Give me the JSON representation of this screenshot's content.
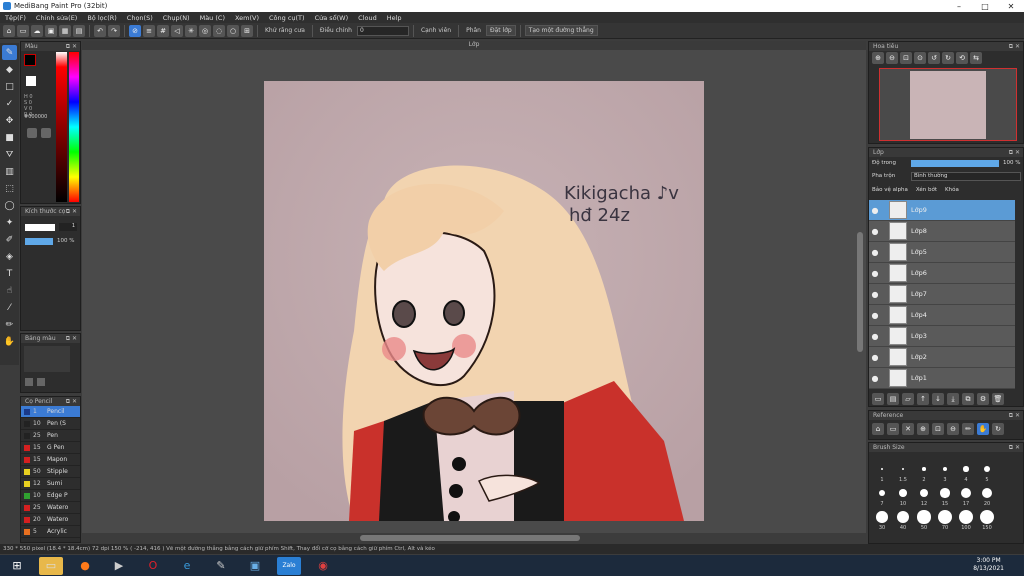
{
  "window": {
    "title": "MediBang Paint Pro (32bit)"
  },
  "menu": [
    "Tệp(F)",
    "Chỉnh sửa(E)",
    "Bộ lọc(R)",
    "Chọn(S)",
    "Chụp(N)",
    "Màu (C)",
    "Xem(V)",
    "Công cụ(T)",
    "Cửa sổ(W)",
    "Cloud",
    "Help"
  ],
  "toolbar": {
    "antialias_label": "Khử răng cưa",
    "adjust_label": "Điều chỉnh",
    "adjust_value": "0",
    "edge_label": "Cạnh viên",
    "fill_label": "Phân",
    "layer_select_label": "Đặt lớp",
    "new_shape_label": "Tạo một đường thẳng"
  },
  "color_panel": {
    "title": "Màu",
    "hex": "#000000"
  },
  "brush_size_panel": {
    "title": "Kích thước cọ",
    "size": "1",
    "opacity": "100 %"
  },
  "color_bar_panel": {
    "title": "Bảng màu"
  },
  "brush_panel": {
    "title": "Cọ Pencil",
    "brushes": [
      {
        "num": "1",
        "name": "Pencil",
        "color": "#1a3a8a"
      },
      {
        "num": "10",
        "name": "Pen (S",
        "color": "#222222"
      },
      {
        "num": "25",
        "name": "Pen",
        "color": "#222222"
      },
      {
        "num": "15",
        "name": "G Pen",
        "color": "#d42020"
      },
      {
        "num": "15",
        "name": "Mapon",
        "color": "#d42020"
      },
      {
        "num": "50",
        "name": "Stipple",
        "color": "#e8d020"
      },
      {
        "num": "12",
        "name": "Sumi",
        "color": "#e8d020"
      },
      {
        "num": "10",
        "name": "Edge P",
        "color": "#30a030"
      },
      {
        "num": "25",
        "name": "Watero",
        "color": "#d42020"
      },
      {
        "num": "20",
        "name": "Watero",
        "color": "#d42020"
      },
      {
        "num": "5",
        "name": "Acrylic",
        "color": "#e87020"
      }
    ]
  },
  "document": {
    "tab": "Lớp",
    "signature_line1": "Kikigacha ♪v",
    "signature_line2": "hđ 24z"
  },
  "navigator": {
    "title": "Hoa tiêu"
  },
  "layers_panel": {
    "title": "Lớp",
    "opacity_label": "Độ trong",
    "opacity_value": "100 %",
    "blend_label": "Pha trộn",
    "blend_value": "Bình thường",
    "protect_alpha": "Bảo vệ alpha",
    "clipping": "Xén bớt",
    "lock": "Khóa",
    "layers": [
      "Lớp9",
      "Lớp8",
      "Lớp5",
      "Lớp6",
      "Lớp7",
      "Lớp4",
      "Lớp3",
      "Lớp2",
      "Lớp1"
    ]
  },
  "reference": {
    "title": "Reference"
  },
  "brush_size": {
    "title": "Brush Size",
    "sizes": [
      "1",
      "1.5",
      "2",
      "3",
      "4",
      "5",
      "7",
      "10",
      "12",
      "15",
      "17",
      "20",
      "30",
      "40",
      "50",
      "70",
      "100",
      "150"
    ]
  },
  "status": "330 * 550 pixel  (18.4 * 18.4cm)  72 dpi  150 %  ( -214, 416 )  Vẽ một đường thẳng bằng cách giữ phím Shift, Thay đổi cỡ cọ bằng cách giữ phím Ctrl, Alt và kéo",
  "clock": {
    "time": "3:00 PM",
    "date": "8/13/2021"
  }
}
